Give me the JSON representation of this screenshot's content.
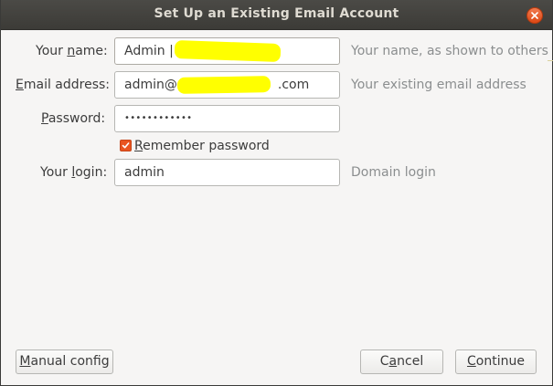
{
  "window": {
    "title": "Set Up an Existing Email Account"
  },
  "form": {
    "name": {
      "label_pre": "Your ",
      "label_key": "n",
      "label_post": "ame:",
      "value": "Admin | ",
      "hint": "Your name, as shown to others"
    },
    "email": {
      "label_key": "E",
      "label_post": "mail address:",
      "value_pre": "admin@",
      "value_post": ".com",
      "hint": "Your existing email address"
    },
    "password": {
      "label_key": "P",
      "label_post": "assword:",
      "value": "••••••••••••"
    },
    "remember": {
      "label_key": "R",
      "label_post": "emember password",
      "checked": true
    },
    "login": {
      "label_pre": "Your ",
      "label_key": "l",
      "label_post": "ogin:",
      "value": "admin",
      "hint": "Domain login"
    }
  },
  "buttons": {
    "manual_config": {
      "key": "M",
      "rest": "anual config"
    },
    "cancel": {
      "pre": "C",
      "key": "a",
      "rest": "ncel"
    },
    "continue": {
      "key": "C",
      "rest": "ontinue"
    }
  },
  "colors": {
    "accent": "#e95420",
    "redaction": "#ffff00",
    "titlebar": "#3c3b37"
  },
  "icons": {
    "close": "close-icon",
    "check": "checkmark-icon"
  }
}
